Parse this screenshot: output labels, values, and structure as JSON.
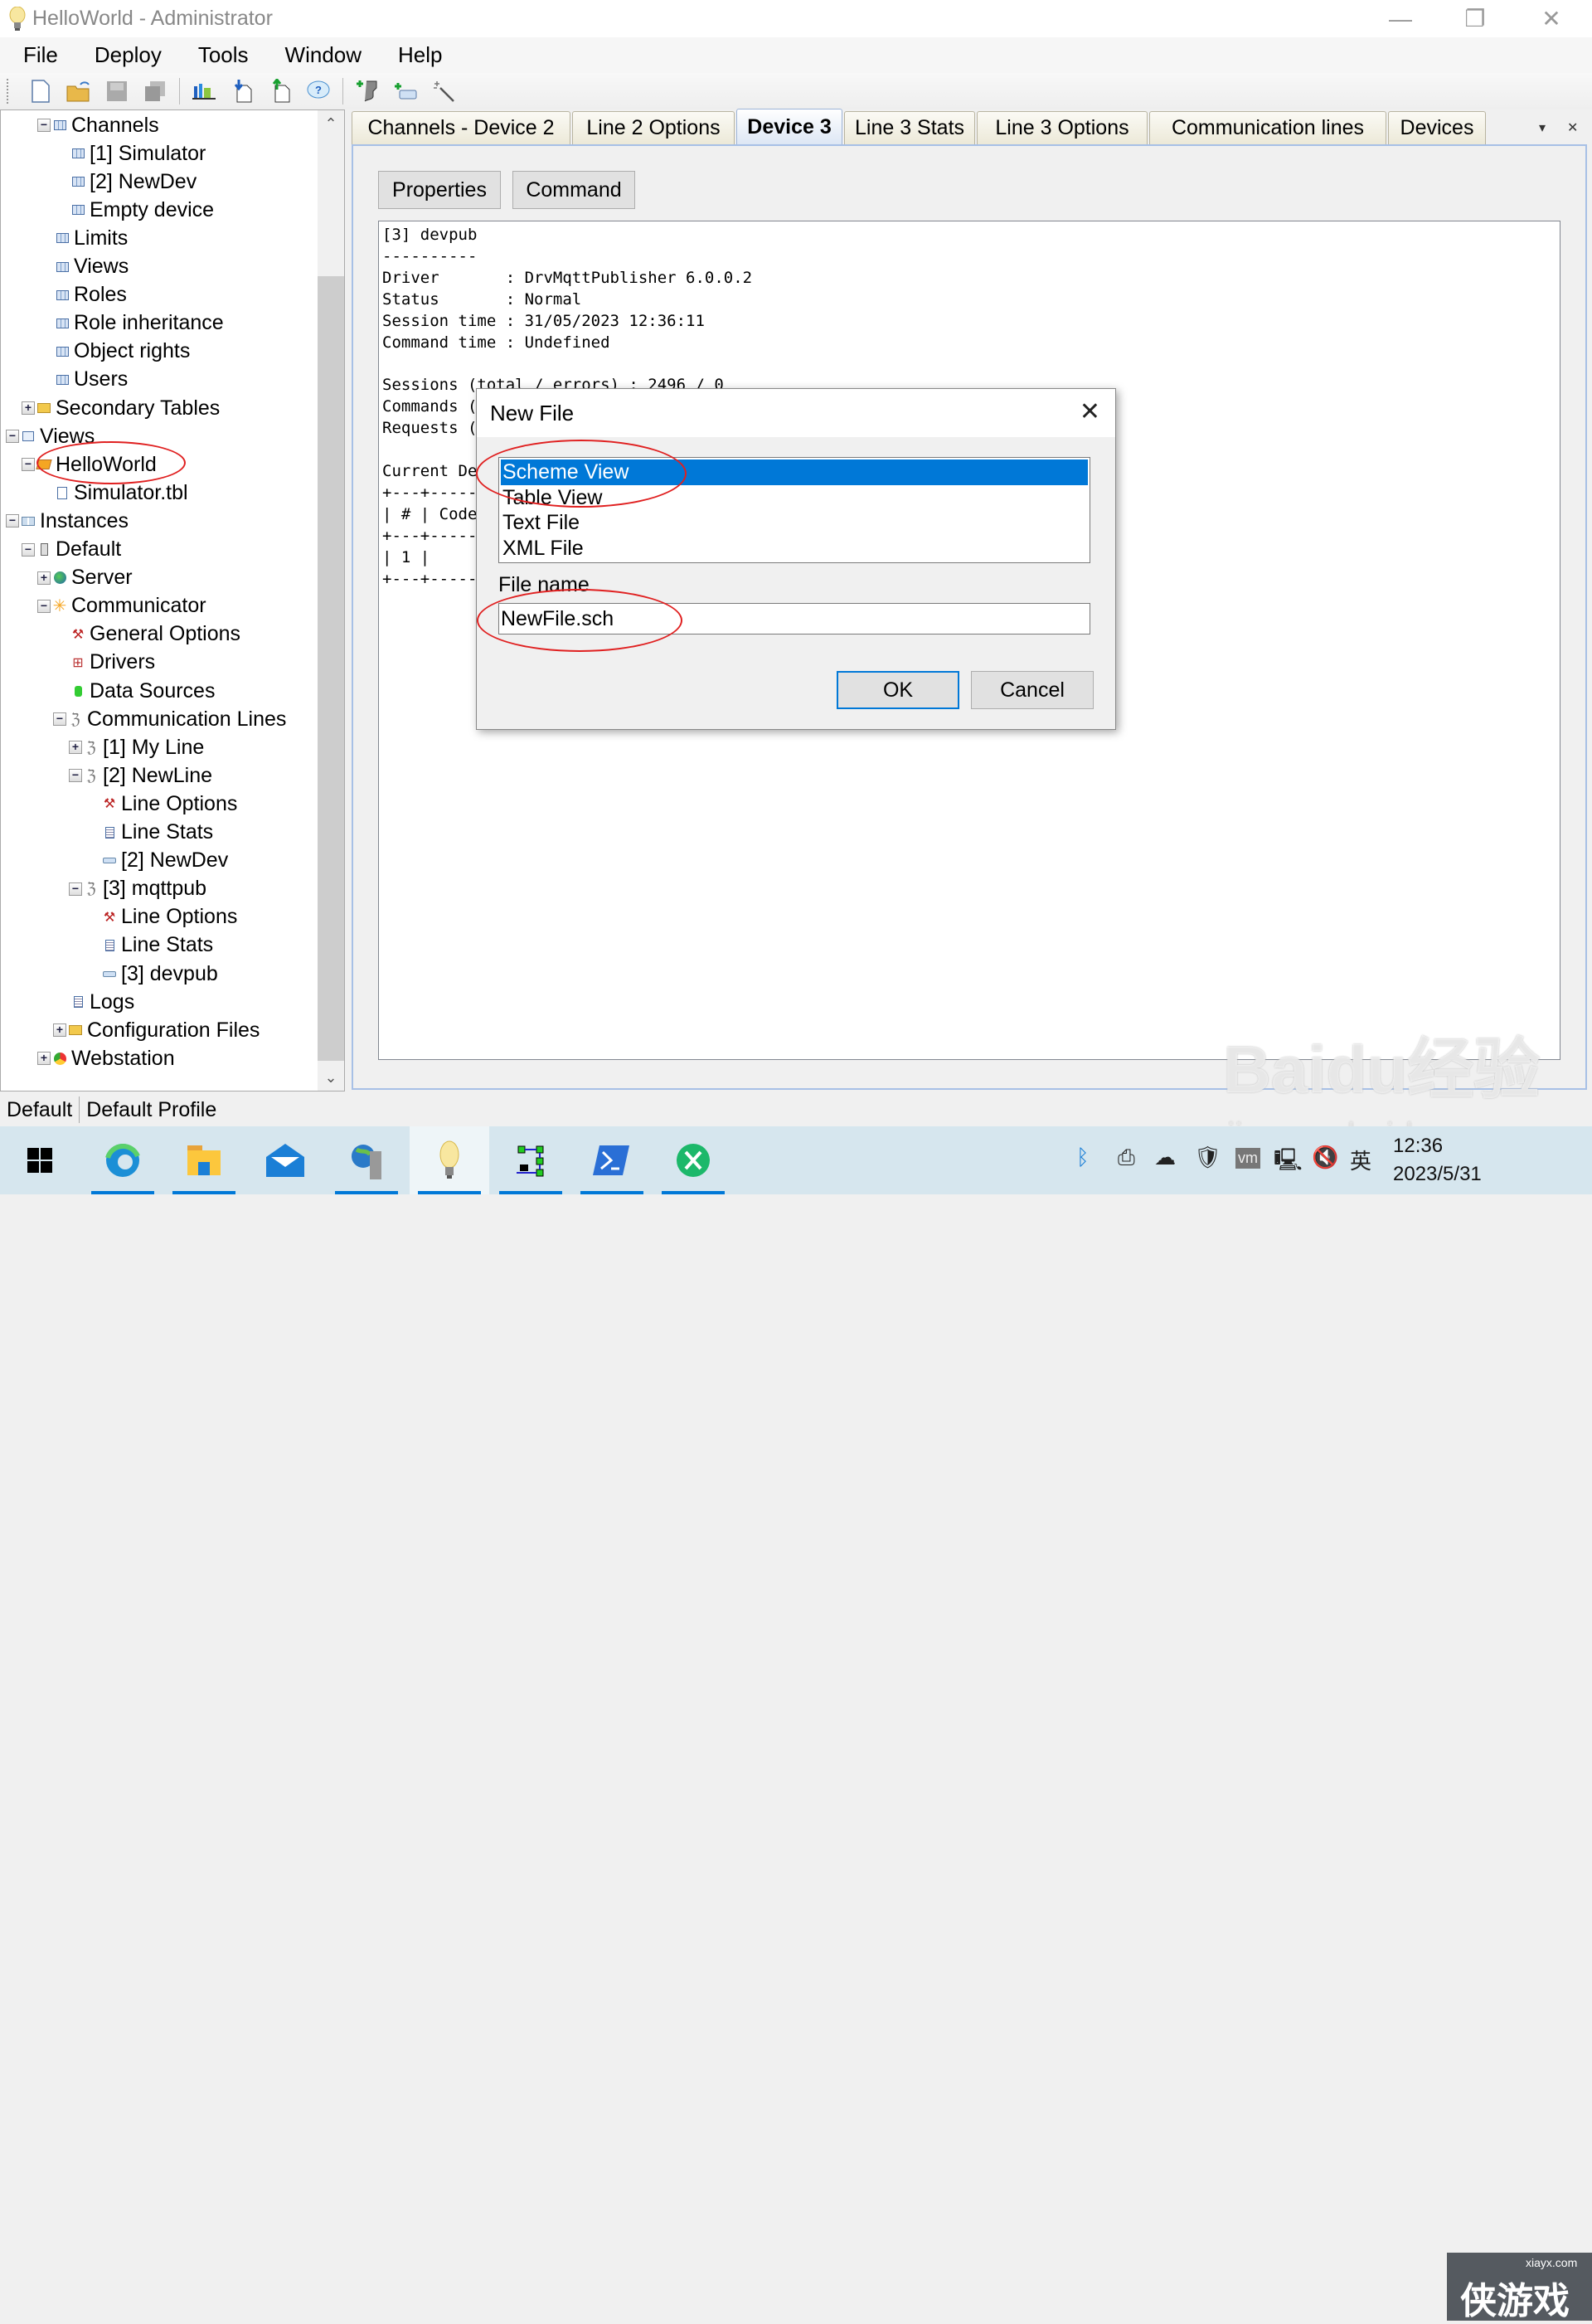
{
  "window": {
    "title": "HelloWorld - Administrator",
    "controls": [
      "minimize",
      "restore",
      "close"
    ]
  },
  "menu": [
    "File",
    "Deploy",
    "Tools",
    "Window",
    "Help"
  ],
  "toolbar": {
    "buttons": [
      "new-file-icon",
      "open-file-icon",
      "save-icon",
      "save-all-icon",
      "chart-icon",
      "import-icon",
      "export-icon",
      "help-icon",
      "add-line-icon",
      "add-device-icon",
      "wizard-icon"
    ]
  },
  "tree": {
    "items": [
      {
        "label": "Channels",
        "level": 2,
        "expander": "-",
        "icon": "table-icon"
      },
      {
        "label": "[1] Simulator",
        "level": 3,
        "icon": "table-icon"
      },
      {
        "label": "[2] NewDev",
        "level": 3,
        "icon": "table-icon"
      },
      {
        "label": "Empty device",
        "level": 3,
        "icon": "table-icon"
      },
      {
        "label": "Limits",
        "level": 2,
        "icon": "table-icon"
      },
      {
        "label": "Views",
        "level": 2,
        "icon": "table-icon"
      },
      {
        "label": "Roles",
        "level": 2,
        "icon": "table-icon"
      },
      {
        "label": "Role inheritance",
        "level": 2,
        "icon": "table-icon"
      },
      {
        "label": "Object rights",
        "level": 2,
        "icon": "table-icon"
      },
      {
        "label": "Users",
        "level": 2,
        "icon": "table-icon"
      },
      {
        "label": "Secondary Tables",
        "level": 1,
        "expander": "+",
        "icon": "folder-icon"
      },
      {
        "label": "Views",
        "level": 0,
        "expander": "-",
        "icon": "views-icon"
      },
      {
        "label": "HelloWorld",
        "level": 1,
        "expander": "-",
        "icon": "open-folder-icon"
      },
      {
        "label": "Simulator.tbl",
        "level": 2,
        "icon": "file-icon"
      },
      {
        "label": "Instances",
        "level": 0,
        "expander": "-",
        "icon": "instances-icon"
      },
      {
        "label": "Default",
        "level": 1,
        "expander": "-",
        "icon": "instance-icon"
      },
      {
        "label": "Server",
        "level": 2,
        "expander": "+",
        "icon": "globe-icon"
      },
      {
        "label": "Communicator",
        "level": 2,
        "expander": "-",
        "icon": "sun-icon"
      },
      {
        "label": "General Options",
        "level": 3,
        "icon": "tools-icon"
      },
      {
        "label": "Drivers",
        "level": 3,
        "icon": "drivers-icon"
      },
      {
        "label": "Data Sources",
        "level": 3,
        "icon": "database-icon"
      },
      {
        "label": "Communication Lines",
        "level": 3,
        "expander": "-",
        "icon": "lines-icon"
      },
      {
        "label": "[1] My Line",
        "level": 4,
        "expander": "+",
        "icon": "cable-icon"
      },
      {
        "label": "[2] NewLine",
        "level": 4,
        "expander": "-",
        "icon": "cable-icon"
      },
      {
        "label": "Line Options",
        "level": 5,
        "icon": "tools-icon"
      },
      {
        "label": "Line Stats",
        "level": 5,
        "icon": "document-icon"
      },
      {
        "label": "[2] NewDev",
        "level": 5,
        "icon": "device-icon"
      },
      {
        "label": "[3] mqttpub",
        "level": 4,
        "expander": "-",
        "icon": "cable-icon"
      },
      {
        "label": "Line Options",
        "level": 5,
        "icon": "tools-icon"
      },
      {
        "label": "Line Stats",
        "level": 5,
        "icon": "document-icon"
      },
      {
        "label": "[3] devpub",
        "level": 5,
        "icon": "device-icon"
      },
      {
        "label": "Logs",
        "level": 3,
        "icon": "document-icon"
      },
      {
        "label": "Configuration Files",
        "level": 3,
        "expander": "+",
        "icon": "folder-icon"
      },
      {
        "label": "Webstation",
        "level": 2,
        "expander": "+",
        "icon": "chrome-icon"
      }
    ]
  },
  "tabs": [
    {
      "label": "Channels - Device 2",
      "active": false
    },
    {
      "label": "Line 2 Options",
      "active": false
    },
    {
      "label": "Device 3",
      "active": true
    },
    {
      "label": "Line 3 Stats",
      "active": false
    },
    {
      "label": "Line 3 Options",
      "active": false
    },
    {
      "label": "Communication lines",
      "active": false
    },
    {
      "label": "Devices",
      "active": false
    }
  ],
  "panel": {
    "properties_label": "Properties",
    "command_label": "Command",
    "output_text": "[3] devpub\n----------\nDriver       : DrvMqttPublisher 6.0.0.2\nStatus       : Normal\nSession time : 31/05/2023 12:36:11\nCommand time : Undefined\n\nSessions (total / errors) : 2496 / 0\nCommands (\nRequests (\n\nCurrent De\n+---+-----\n| # | Code\n+---+-----\n| 1 |\n+---+-----"
  },
  "status_bar": {
    "instance": "Default",
    "profile": "Default Profile"
  },
  "dialog": {
    "title": "New File",
    "file_types": [
      "Scheme View",
      "Table View",
      "Text File",
      "XML File"
    ],
    "selected_index": 0,
    "file_name_label": "File name",
    "file_name_value": "NewFile.sch",
    "ok_label": "OK",
    "cancel_label": "Cancel"
  },
  "taskbar": {
    "apps": [
      "start-icon",
      "edge-icon",
      "file-explorer-icon",
      "mail-icon",
      "network-app-icon",
      "administrator-app-icon",
      "scheme-editor-icon",
      "powershell-icon",
      "remote-app-icon"
    ],
    "active_app": "administrator-app-icon",
    "tray": [
      "bluetooth-icon",
      "usb-icon",
      "onedrive-icon",
      "defender-icon",
      "vmware-icon",
      "network-icon",
      "volume-muted-icon"
    ],
    "ime": "英",
    "time": "12:36",
    "date": "2023/5/31"
  },
  "watermark": {
    "main": "Baidu经验",
    "sub": "jingyan.baidu.com",
    "corner_site": "xiayx.com",
    "corner_text": "侠游戏"
  },
  "colors": {
    "selection": "#0078d7",
    "annotation": "#e02020",
    "tab_active_border": "#9cb4d8"
  }
}
